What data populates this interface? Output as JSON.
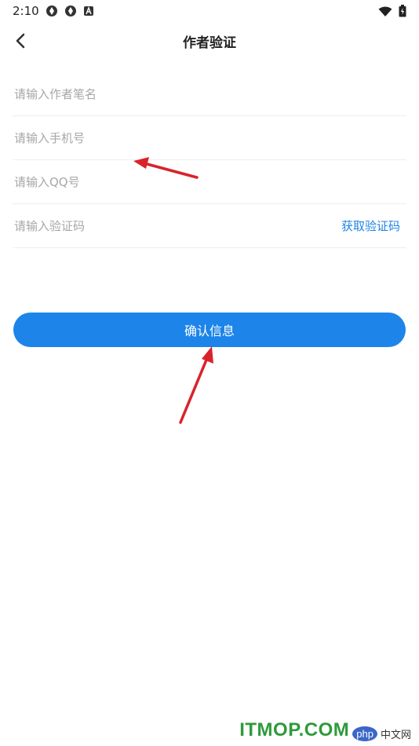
{
  "status_bar": {
    "time": "2:10",
    "icons_left": [
      "sync-icon",
      "sync-icon",
      "notification-a-icon"
    ],
    "icons_right": [
      "wifi-icon",
      "battery-icon"
    ]
  },
  "header": {
    "title": "作者验证",
    "back_icon": "chevron-left-icon"
  },
  "form": {
    "pen_name_placeholder": "请输入作者笔名",
    "phone_placeholder": "请输入手机号",
    "qq_placeholder": "请输入QQ号",
    "code_placeholder": "请输入验证码",
    "get_code_label": "获取验证码"
  },
  "confirm_button": {
    "label": "确认信息"
  },
  "watermark": {
    "main": "ITMOP.COM",
    "php": "php",
    "cn": "中文网"
  },
  "colors": {
    "accent": "#1d84e9",
    "link": "#1f84e8",
    "arrow": "#d9232b",
    "watermark": "#2f9a3b"
  }
}
